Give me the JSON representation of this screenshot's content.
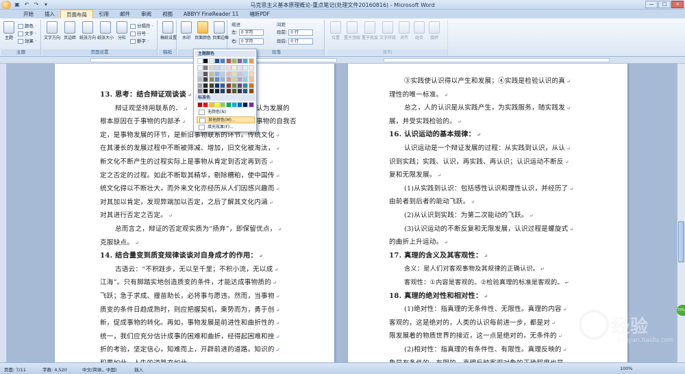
{
  "window": {
    "title": "马克思主义基本原理概论-重点笔记(处理文件20160816) - Microsoft Word",
    "controls": [
      "—",
      "□",
      "×"
    ]
  },
  "tabs": [
    "开始",
    "插入",
    "页面布局",
    "引用",
    "邮件",
    "审阅",
    "视图",
    "ABBYY FineReader 11",
    "福昕PDF"
  ],
  "ribbon": {
    "theme_group": {
      "label": "主题",
      "main_button": "主题",
      "items": [
        "颜色 ·",
        "文字 ·",
        "效果 ·"
      ]
    },
    "page_setup_group": {
      "label": "页面设置",
      "buttons": [
        "文字方向",
        "页边距",
        "纸张方向",
        "纸张大小",
        "分栏"
      ],
      "small": [
        "分隔符 ·",
        "行号 ·",
        "断字 ·"
      ]
    },
    "manuscript_group": {
      "label": "稿纸",
      "button": "稿纸设置"
    },
    "background_group": {
      "label": "页面背景",
      "buttons": [
        "水印",
        "页面颜色",
        "页面边框"
      ]
    },
    "paragraph_group": {
      "label": "段落",
      "indent_title": "缩进",
      "spacing_title": "间距",
      "left_label": "左:",
      "right_label": "右:",
      "before_label": "段前:",
      "after_label": "段后:",
      "left_value": "0 字符",
      "right_value": "0 字符",
      "before_value": "0 行",
      "after_value": "0 行"
    },
    "arrange_group": {
      "label": "排列",
      "buttons": [
        "位置",
        "置于顶层",
        "置于底层",
        "文字环绕",
        "对齐",
        "组合",
        "旋转"
      ]
    }
  },
  "color_dropdown": {
    "theme_title": "主题颜色",
    "standard_title": "标准色",
    "items": [
      "无颜色(N)",
      "其他颜色(M)...",
      "填充效果(F)..."
    ],
    "theme_colors": [
      [
        "#ffffff",
        "#000000",
        "#eeece1",
        "#1f497d",
        "#4f81bd",
        "#c0504d",
        "#9bbb59",
        "#8064a2",
        "#4bacc6",
        "#f79646"
      ],
      [
        "#f2f2f2",
        "#7f7f7f",
        "#ddd9c3",
        "#c6d9f0",
        "#dbe5f1",
        "#f2dcdb",
        "#ebf1dd",
        "#e5e0ec",
        "#dbeef3",
        "#fdeada"
      ],
      [
        "#d8d8d8",
        "#595959",
        "#c4bd97",
        "#8db3e2",
        "#b8cce4",
        "#e5b9b7",
        "#d7e3bc",
        "#ccc1d9",
        "#b7dde8",
        "#fbd5b5"
      ],
      [
        "#bfbfbf",
        "#3f3f3f",
        "#938953",
        "#548dd4",
        "#95b3d7",
        "#d99694",
        "#c3d69b",
        "#b2a2c7",
        "#92cddc",
        "#fac08f"
      ],
      [
        "#a5a5a5",
        "#262626",
        "#494429",
        "#17365d",
        "#366092",
        "#953734",
        "#76923c",
        "#5f497a",
        "#31859b",
        "#e36c09"
      ],
      [
        "#7f7f7f",
        "#0c0c0c",
        "#1d1b10",
        "#0f243e",
        "#244061",
        "#632423",
        "#4f6128",
        "#3f3151",
        "#205867",
        "#974806"
      ]
    ],
    "standard_colors": [
      "#c00000",
      "#ff0000",
      "#ffc000",
      "#ffff00",
      "#92d050",
      "#00b050",
      "#00b0f0",
      "#0070c0",
      "#002060",
      "#7030a0"
    ]
  },
  "page1_lines": [
    {
      "t": "13. 思考：结合辩证观谈谈",
      "h": true
    },
    {
      "t": "辩证观坚持用联系的、",
      "indent": true,
      "tail": "认为发展的"
    },
    {
      "t": "根本原因在于事物的内部矛",
      "tail": "事物的自我否"
    },
    {
      "t": "定，是事物发展的环节，是新旧事物联系的环节。传统文化"
    },
    {
      "t": "在其漫长的发展过程中不断被筛减、增加，旧文化被淘汰，"
    },
    {
      "t": "新文化不断产生的过程实际上是事物从肯定到否定再到否"
    },
    {
      "t": "定之否定的过程。如此不断取其精华，剔除糟粕，使中国传"
    },
    {
      "t": "统文化得以不断壮大，而外来文化亦经历从人们因感兴趣而"
    },
    {
      "t": "对其加以肯定，发现弊端加以否定，之后了解其文化内涵"
    },
    {
      "t": "对其进行否定之否定。"
    },
    {
      "t": "总而言之，辩证的否定观实质为“扬弃”，即保留优点，",
      "indent": true
    },
    {
      "t": "克服缺点。"
    },
    {
      "t": "14.    结合量变到质变规律谈谈对自身成才的作用：",
      "h": true
    },
    {
      "t": "古语云：“不积跬步，无以至千里；不积小流，无以成",
      "indent": true
    },
    {
      "t": "江海”。只有脚踏实地创造质变的条件，才能达成事物质的"
    },
    {
      "t": "飞跃；急于求成、揠苗助长，必将事与愿违。然而，当事物"
    },
    {
      "t": "质变的条件日趋成熟时，则应把握契机，乘势而为，勇于创"
    },
    {
      "t": "新，促成事物的转化。再如，事物发展是前进性和曲折性的"
    },
    {
      "t": "统一，我们应充分估计成事的困难和曲折，经得起困难和挫"
    },
    {
      "t": "折的考验，坚定信心，知难而上，开辟前进的道路。知识的"
    },
    {
      "t": "积累如此，人生的道路亦如此。"
    }
  ],
  "page2_lines": [
    {
      "t": "③实践使认识得以产生和发展；④实践是检验认识的真",
      "indent": true
    },
    {
      "t": "理性的唯一标准。"
    },
    {
      "t": "总之，人的认识是从实践产生，为实践服务，随实践发",
      "indent": true
    },
    {
      "t": "展，并受实践检验的。"
    },
    {
      "t": "16. 认识运动的基本规律：",
      "h": true
    },
    {
      "t": "认识运动是一个辩证发展的过程：从实践到认识，从认",
      "indent": true
    },
    {
      "t": "识到实践；实践、认识，再实践、再认识；认识运动不断反"
    },
    {
      "t": "复和无限发展。"
    },
    {
      "t": "(1)从实践到认识：包括感性认识和理性认识，并经历了",
      "indent": true
    },
    {
      "t": "由前者到后者的能动飞跃。"
    },
    {
      "t": "(2)从认识到实践：为第二次能动的飞跃。",
      "indent": true
    },
    {
      "t": "(3)认识运动的不断反复和无限发展，认识过程是螺旋式",
      "indent": true
    },
    {
      "t": "的曲折上升运动。"
    },
    {
      "t": "17. 真理的含义及其客观性：",
      "h": true
    },
    {
      "t": "含义：是人们对客观事物及其规律的正确认识。",
      "indent": true,
      "sans": true
    },
    {
      "t": "客观性：①内容是客观的。②检验真理的标准是客观的。",
      "indent": true,
      "sans": true
    },
    {
      "t": "18. 真理的绝对性和相对性：",
      "h": true
    },
    {
      "t": "(1)绝对性：指真理的无条件性、无限性。真理的内容",
      "indent": true
    },
    {
      "t": "客观的，这是绝对的，人类的认识每前进一步，都是对"
    },
    {
      "t": "限发展着的物质世界的接近，这一点是绝对的，无条件的"
    },
    {
      "t": "(2)相对性：指真理的有条件性、有限性。真理反映的",
      "indent": true
    },
    {
      "t": "象是有条件的，有限的。真理反映客观对象的正确程度也是"
    }
  ],
  "status": {
    "page": "页面: 7/11",
    "words": "字数: 4,520",
    "lang": "中文(简体，中国)",
    "mode": "插入",
    "zoom": "100%"
  },
  "watermark": {
    "brand": "经验",
    "sub": "jingyan.baidu.com"
  },
  "side_badge": "70%"
}
